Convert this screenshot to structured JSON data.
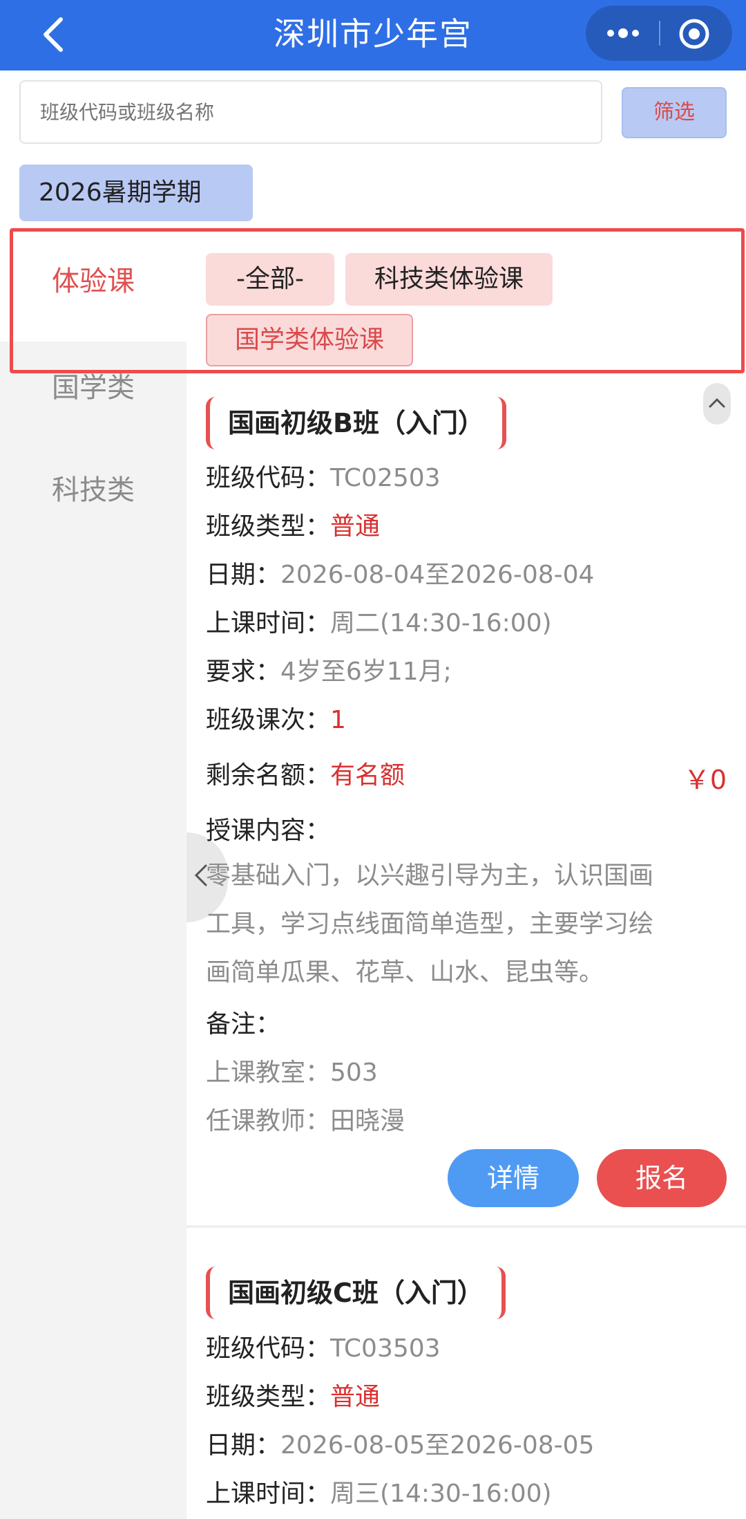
{
  "header": {
    "title": "深圳市少年宫"
  },
  "search": {
    "placeholder": "班级代码或班级名称",
    "filter_label": "筛选"
  },
  "term": {
    "selected": "2026暑期学期"
  },
  "categories": [
    "体验课",
    "国学类",
    "科技类"
  ],
  "active_category": "体验课",
  "subcategories": [
    "-全部-",
    "科技类体验课",
    "国学类体验课"
  ],
  "selected_subcategory": "国学类体验课",
  "colors": {
    "header": "#2f6fe6",
    "accent_red": "#ee4b4b",
    "detail_button": "#4f9bf4",
    "signup_button": "#ea5050"
  },
  "icons": [
    "back-arrow-icon",
    "more-dots-icon",
    "target-circle-icon",
    "chevron-up-icon",
    "chevron-left-icon"
  ],
  "courses": [
    {
      "title": "国画初级B班（入门）",
      "code_label": "班级代码：",
      "code": "TC02503",
      "type_label": "班级类型：",
      "type": "普通",
      "date_label": "日期：",
      "date": "2026-08-04至2026-08-04",
      "time_label": "上课时间：",
      "time": "周二(14:30-16:00)",
      "req_label": "要求：",
      "req": "4岁至6岁11月;",
      "sessions_label": "班级课次：",
      "sessions": "1",
      "quota_label": "剩余名额：",
      "quota": "有名额",
      "price": "￥0",
      "content_label": "授课内容：",
      "content_lines": [
        "零基础入门，以兴趣引导为主，认识国画",
        "工具，学习点线面简单造型，主要学习绘",
        "画简单瓜果、花草、山水、昆虫等。"
      ],
      "remark_label": "备注：",
      "room_label": "上课教室：",
      "room": "503",
      "teacher_label": "任课教师：",
      "teacher": "田晓漫",
      "detail_label": "详情",
      "signup_label": "报名"
    },
    {
      "title": "国画初级C班（入门）",
      "code_label": "班级代码：",
      "code": "TC03503",
      "type_label": "班级类型：",
      "type": "普通",
      "date_label": "日期：",
      "date": "2026-08-05至2026-08-05",
      "time_label": "上课时间：",
      "time": "周三(14:30-16:00)"
    }
  ]
}
